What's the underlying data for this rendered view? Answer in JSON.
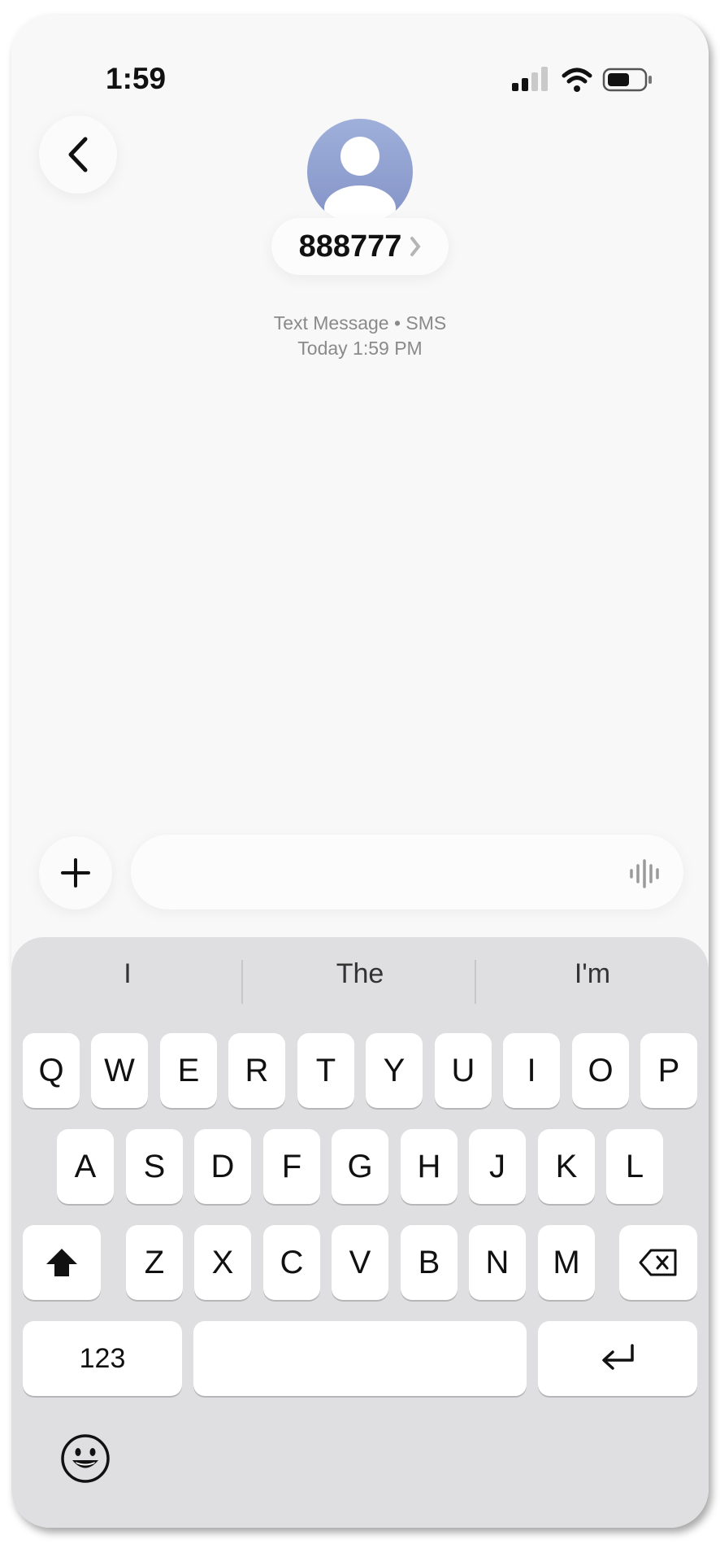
{
  "status_bar": {
    "time": "1:59"
  },
  "contact": {
    "name": "888777"
  },
  "conversation": {
    "type_label": "Text Message • SMS",
    "timestamp": "Today 1:59 PM"
  },
  "composer": {
    "placeholder": ""
  },
  "keyboard": {
    "suggestions": [
      "I",
      "The",
      "I'm"
    ],
    "row1": [
      "Q",
      "W",
      "E",
      "R",
      "T",
      "Y",
      "U",
      "I",
      "O",
      "P"
    ],
    "row2": [
      "A",
      "S",
      "D",
      "F",
      "G",
      "H",
      "J",
      "K",
      "L"
    ],
    "row3": [
      "Z",
      "X",
      "C",
      "V",
      "B",
      "N",
      "M"
    ],
    "numbers_key": "123"
  },
  "icons": [
    "back-chevron-icon",
    "person-icon",
    "contact-chevron-icon",
    "signal-icon",
    "wifi-icon",
    "battery-icon",
    "plus-icon",
    "voice-waveform-icon",
    "shift-icon",
    "delete-icon",
    "return-icon",
    "emoji-icon"
  ]
}
